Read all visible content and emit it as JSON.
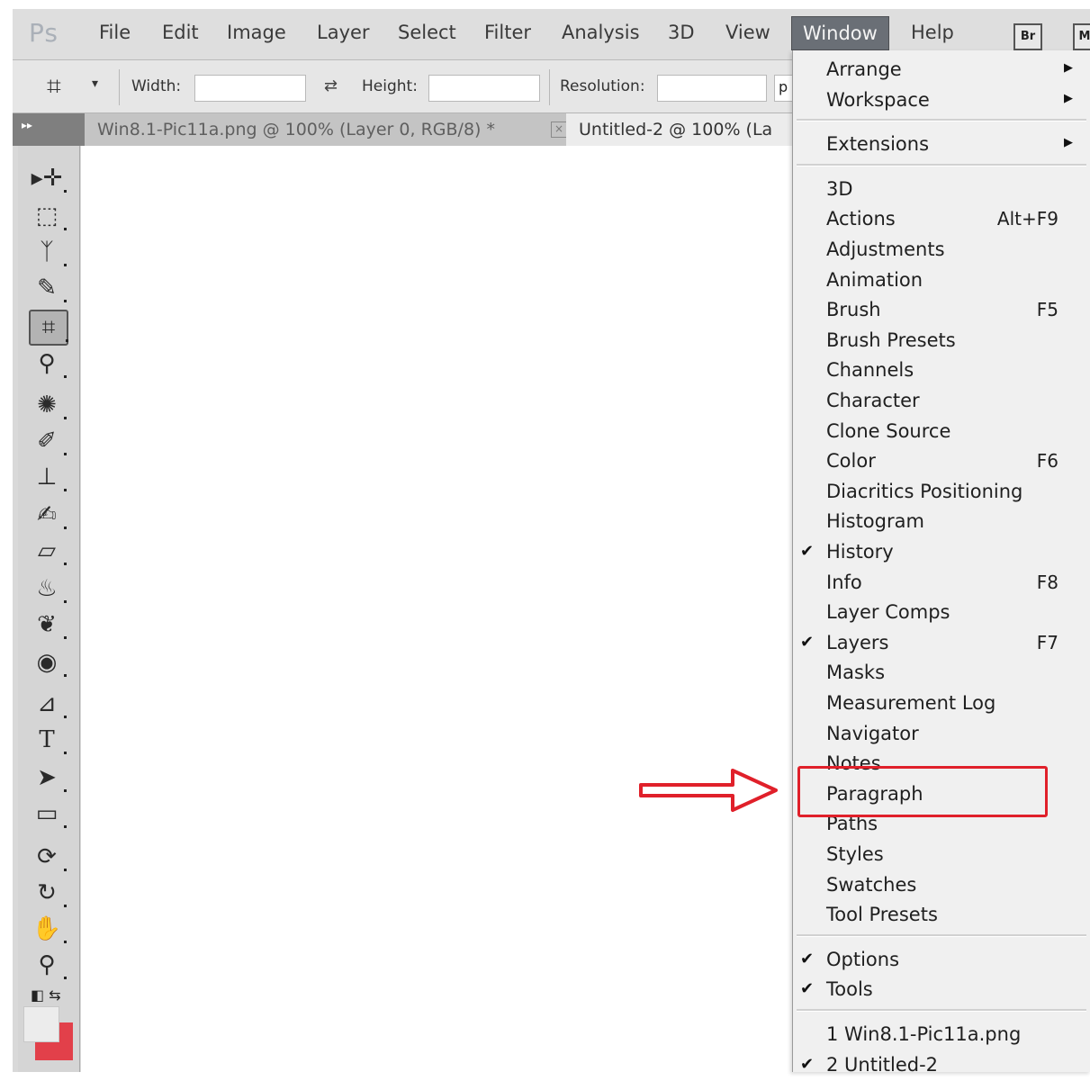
{
  "app": {
    "logo": "Ps"
  },
  "menubar": {
    "items": [
      "File",
      "Edit",
      "Image",
      "Layer",
      "Select",
      "Filter",
      "Analysis",
      "3D",
      "View",
      "Window",
      "Help"
    ],
    "active": "Window",
    "bridge_badge": "Br",
    "mini_badge": "M"
  },
  "options_bar": {
    "width_label": "Width:",
    "height_label": "Height:",
    "resolution_label": "Resolution:",
    "width_value": "",
    "height_value": "",
    "resolution_value": "",
    "truncated_field": "p"
  },
  "tabs": [
    {
      "title": "Win8.1-Pic11a.png @ 100% (Layer 0, RGB/8) *",
      "close": "×"
    },
    {
      "title": "Untitled-2 @ 100% (La"
    }
  ],
  "toolbox": {
    "icons": [
      "move-tool-icon",
      "marquee-tool-icon",
      "lasso-tool-icon",
      "quick-selection-tool-icon",
      "crop-tool-icon",
      "eyedropper-tool-icon",
      "spot-healing-tool-icon",
      "brush-tool-icon",
      "clone-stamp-tool-icon",
      "history-brush-tool-icon",
      "eraser-tool-icon",
      "paint-bucket-tool-icon",
      "blur-tool-icon",
      "dodge-tool-icon",
      "pen-tool-icon",
      "type-tool-icon",
      "path-selection-tool-icon",
      "rectangle-tool-icon",
      "3d-rotate-tool-icon",
      "3d-orbit-tool-icon",
      "hand-tool-icon",
      "zoom-tool-icon"
    ],
    "selected": "crop-tool-icon",
    "foreground_color": "#ececec",
    "background_color": "#e2404a"
  },
  "window_menu": {
    "groups": [
      [
        {
          "label": "Arrange",
          "submenu": true
        },
        {
          "label": "Workspace",
          "submenu": true
        }
      ],
      [
        {
          "label": "Extensions",
          "submenu": true
        }
      ],
      [
        {
          "label": "3D"
        },
        {
          "label": "Actions",
          "shortcut": "Alt+F9"
        },
        {
          "label": "Adjustments"
        },
        {
          "label": "Animation"
        },
        {
          "label": "Brush",
          "shortcut": "F5"
        },
        {
          "label": "Brush Presets"
        },
        {
          "label": "Channels"
        },
        {
          "label": "Character"
        },
        {
          "label": "Clone Source"
        },
        {
          "label": "Color",
          "shortcut": "F6"
        },
        {
          "label": "Diacritics Positioning"
        },
        {
          "label": "Histogram"
        },
        {
          "label": "History",
          "checked": true
        },
        {
          "label": "Info",
          "shortcut": "F8"
        },
        {
          "label": "Layer Comps"
        },
        {
          "label": "Layers",
          "shortcut": "F7",
          "checked": true
        },
        {
          "label": "Masks"
        },
        {
          "label": "Measurement Log"
        },
        {
          "label": "Navigator"
        },
        {
          "label": "Notes"
        },
        {
          "label": "Paragraph",
          "highlighted": true
        },
        {
          "label": "Paths"
        },
        {
          "label": "Styles"
        },
        {
          "label": "Swatches"
        },
        {
          "label": "Tool Presets"
        }
      ],
      [
        {
          "label": "Options",
          "checked": true
        },
        {
          "label": "Tools",
          "checked": true
        }
      ],
      [
        {
          "label": "1 Win8.1-Pic11a.png"
        },
        {
          "label": "2 Untitled-2",
          "checked": true
        }
      ]
    ]
  },
  "annotation": {
    "color": "#e0202a",
    "highlighted_item": "Paragraph"
  }
}
